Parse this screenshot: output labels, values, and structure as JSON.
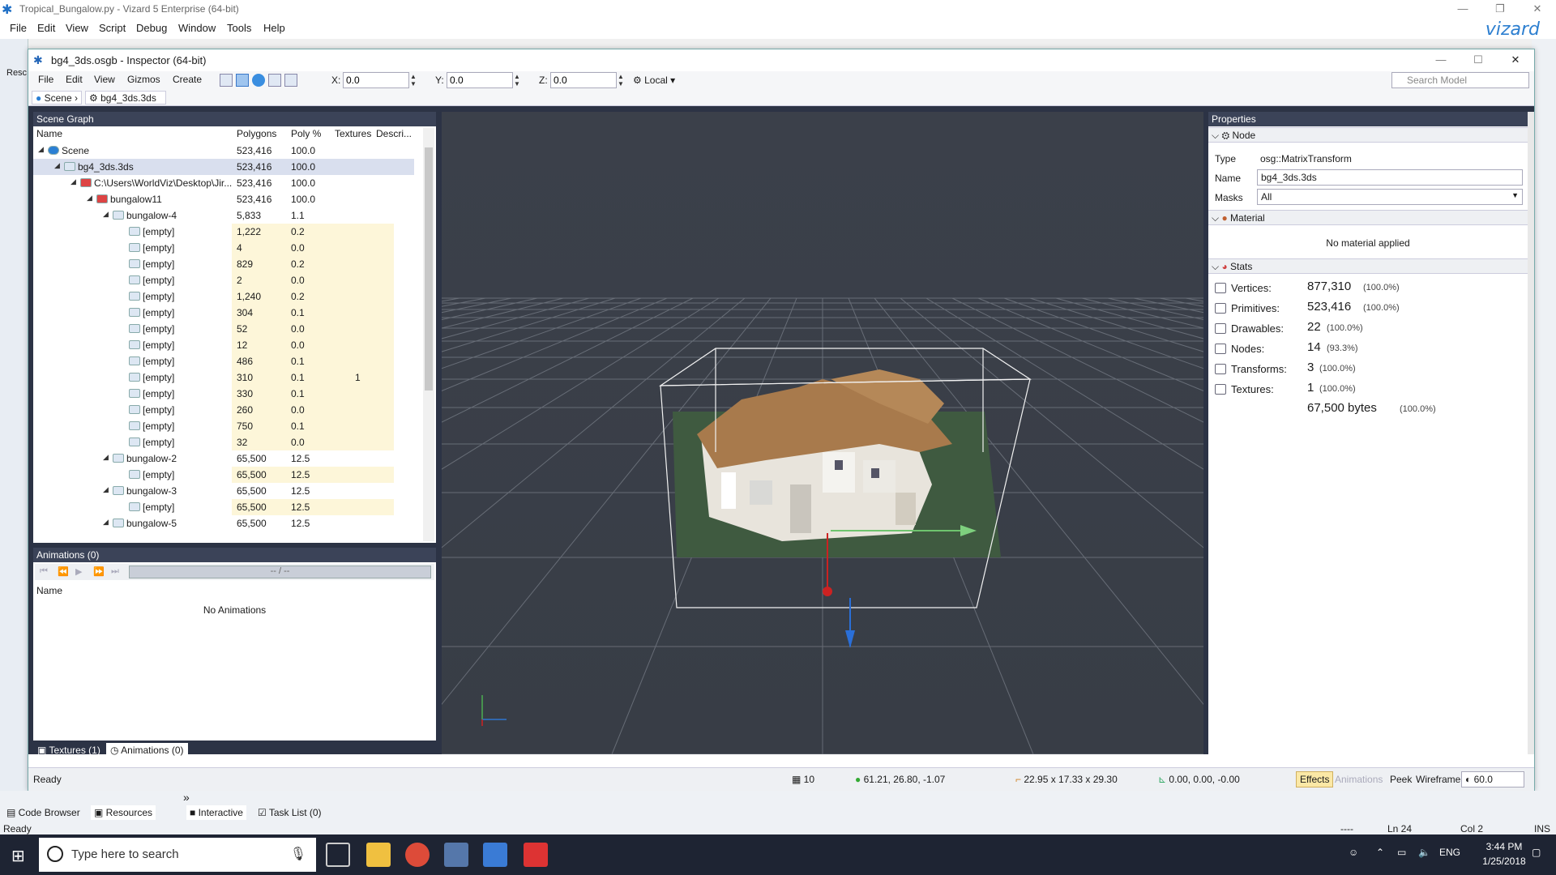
{
  "outer": {
    "title": "Tropical_Bungalow.py - Vizard 5 Enterprise (64-bit)",
    "menu": [
      "File",
      "Edit",
      "View",
      "Script",
      "Debug",
      "Window",
      "Tools",
      "Help"
    ],
    "brand": "vizard",
    "left_label": "Resc",
    "bottom_tabs": [
      "Code Browser",
      "Resources",
      "Interactive",
      "Task List (0)"
    ],
    "status": "Ready",
    "status_right": {
      "sep": "----",
      "ln": "Ln 24",
      "col": "Col 2",
      "mode": "INS"
    }
  },
  "inspector": {
    "title": "bg4_3ds.osgb - Inspector (64-bit)",
    "menu": [
      "File",
      "Edit",
      "View",
      "Gizmos",
      "Create"
    ],
    "coords": {
      "x_label": "X:",
      "x": "0.0",
      "y_label": "Y:",
      "y": "0.0",
      "z_label": "Z:",
      "z": "0.0"
    },
    "space": "Local",
    "search_placeholder": "Search Model",
    "breadcrumb": [
      "Scene",
      "bg4_3ds.3ds"
    ]
  },
  "scene_graph": {
    "title": "Scene Graph",
    "columns": [
      "Name",
      "Polygons",
      "Poly %",
      "Textures",
      "Descri..."
    ],
    "rows": [
      {
        "name": "Scene",
        "poly": "523,416",
        "pct": "100.0",
        "tex": "",
        "depth": 0
      },
      {
        "name": "bg4_3ds.3ds",
        "poly": "523,416",
        "pct": "100.0",
        "tex": "",
        "depth": 1
      },
      {
        "name": "C:\\Users\\WorldViz\\Desktop\\Jir...",
        "poly": "523,416",
        "pct": "100.0",
        "tex": "",
        "depth": 2
      },
      {
        "name": "bungalow11",
        "poly": "523,416",
        "pct": "100.0",
        "tex": "",
        "depth": 3
      },
      {
        "name": "bungalow-4",
        "poly": "5,833",
        "pct": "1.1",
        "tex": "",
        "depth": 4
      },
      {
        "name": "[empty]",
        "poly": "1,222",
        "pct": "0.2",
        "tex": "",
        "depth": 5
      },
      {
        "name": "[empty]",
        "poly": "4",
        "pct": "0.0",
        "tex": "",
        "depth": 5
      },
      {
        "name": "[empty]",
        "poly": "829",
        "pct": "0.2",
        "tex": "",
        "depth": 5
      },
      {
        "name": "[empty]",
        "poly": "2",
        "pct": "0.0",
        "tex": "",
        "depth": 5
      },
      {
        "name": "[empty]",
        "poly": "1,240",
        "pct": "0.2",
        "tex": "",
        "depth": 5
      },
      {
        "name": "[empty]",
        "poly": "304",
        "pct": "0.1",
        "tex": "",
        "depth": 5
      },
      {
        "name": "[empty]",
        "poly": "52",
        "pct": "0.0",
        "tex": "",
        "depth": 5
      },
      {
        "name": "[empty]",
        "poly": "12",
        "pct": "0.0",
        "tex": "",
        "depth": 5
      },
      {
        "name": "[empty]",
        "poly": "486",
        "pct": "0.1",
        "tex": "",
        "depth": 5
      },
      {
        "name": "[empty]",
        "poly": "310",
        "pct": "0.1",
        "tex": "1",
        "depth": 5
      },
      {
        "name": "[empty]",
        "poly": "330",
        "pct": "0.1",
        "tex": "",
        "depth": 5
      },
      {
        "name": "[empty]",
        "poly": "260",
        "pct": "0.0",
        "tex": "",
        "depth": 5
      },
      {
        "name": "[empty]",
        "poly": "750",
        "pct": "0.1",
        "tex": "",
        "depth": 5
      },
      {
        "name": "[empty]",
        "poly": "32",
        "pct": "0.0",
        "tex": "",
        "depth": 5
      },
      {
        "name": "bungalow-2",
        "poly": "65,500",
        "pct": "12.5",
        "tex": "",
        "depth": 4
      },
      {
        "name": "[empty]",
        "poly": "65,500",
        "pct": "12.5",
        "tex": "",
        "depth": 5
      },
      {
        "name": "bungalow-3",
        "poly": "65,500",
        "pct": "12.5",
        "tex": "",
        "depth": 4
      },
      {
        "name": "[empty]",
        "poly": "65,500",
        "pct": "12.5",
        "tex": "",
        "depth": 5
      },
      {
        "name": "bungalow-5",
        "poly": "65,500",
        "pct": "12.5",
        "tex": "",
        "depth": 4
      }
    ]
  },
  "animations": {
    "title": "Animations (0)",
    "progress": "-- / --",
    "column": "Name",
    "empty": "No Animations"
  },
  "left_bottom_tabs": [
    "Textures (1)",
    "Animations (0)"
  ],
  "properties": {
    "title": "Properties",
    "node_section": "Node",
    "type_label": "Type",
    "type_value": "osg::MatrixTransform",
    "name_label": "Name",
    "name_value": "bg4_3ds.3ds",
    "masks_label": "Masks",
    "masks_value": "All",
    "material_section": "Material",
    "material_empty": "No material applied",
    "stats_section": "Stats",
    "stats": [
      {
        "label": "Vertices:",
        "value": "877,310",
        "pct": "(100.0%)",
        "icon": "vertices-icon"
      },
      {
        "label": "Primitives:",
        "value": "523,416",
        "pct": "(100.0%)",
        "icon": "primitives-icon"
      },
      {
        "label": "Drawables:",
        "value": "22",
        "pct": "(100.0%)",
        "icon": "drawables-icon"
      },
      {
        "label": "Nodes:",
        "value": "14",
        "pct": "(93.3%)",
        "icon": "nodes-icon"
      },
      {
        "label": "Transforms:",
        "value": "3",
        "pct": "(100.0%)",
        "icon": "transforms-icon"
      },
      {
        "label": "Textures:",
        "value": "1",
        "pct": "(100.0%)",
        "icon": "textures-icon"
      },
      {
        "label": "",
        "value": "67,500 bytes",
        "pct": "(100.0%)",
        "icon": ""
      }
    ]
  },
  "inspector_status": {
    "ready": "Ready",
    "grid": "10",
    "position": "61.21, 26.80, -1.07",
    "size": "22.95 x 17.33 x 29.30",
    "rotation": "0.00, 0.00, -0.00",
    "buttons": [
      "Effects",
      "Animations",
      "Peek",
      "Wireframe"
    ],
    "fov": "60.0"
  },
  "taskbar": {
    "search_placeholder": "Type here to search",
    "lang": "ENG",
    "time": "3:44 PM",
    "date": "1/25/2018"
  }
}
